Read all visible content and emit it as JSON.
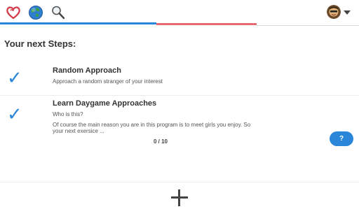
{
  "header": {
    "icons": [
      "heart-icon",
      "globe-icon",
      "magnifier-icon"
    ],
    "avatar_icon": "avatar-icon",
    "menu_icon": "caret-down-icon",
    "progress": {
      "blue": 0.435,
      "red": 0.28
    }
  },
  "main": {
    "section_title": "Your next Steps:",
    "steps": [
      {
        "title": "Random Approach",
        "description": "Approach a random stranger of your interest"
      },
      {
        "title": "Learn Daygame Approaches",
        "subtitle": "Who is this?",
        "description_line1": "Of course the main reason you are in this program is to meet girls you enjoy. So",
        "description_line2": "your next exersice ..."
      }
    ],
    "counter": "0 / 10",
    "help_label": "?",
    "add_icon": "plus-icon"
  },
  "colors": {
    "accent_blue": "#2a86d9",
    "accent_red": "#e56a6f"
  }
}
